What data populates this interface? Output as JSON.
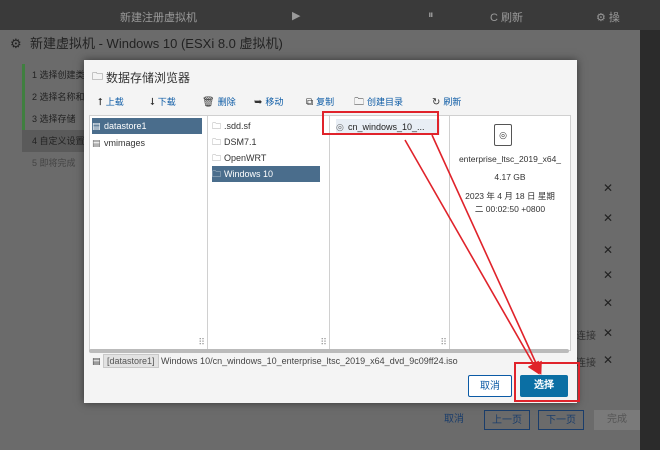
{
  "background_app": {
    "topbar_items": [
      "新建注册虚拟机",
      "▶",
      "⏸",
      "C 刷新",
      "⚙ 操"
    ],
    "window_title": "新建虚拟机 - Windows 10 (ESXi 8.0 虚拟机)",
    "steps": [
      {
        "label": "1  选择创建类型",
        "active": true
      },
      {
        "label": "2  选择名称和客",
        "active": true
      },
      {
        "label": "3  选择存储",
        "active": true
      },
      {
        "label": "4  自定义设置",
        "active": false
      },
      {
        "label": "5  即将完成",
        "active": false
      }
    ],
    "right_labels": [
      "连接",
      "连接"
    ],
    "footer": {
      "cancel": "取消",
      "back": "上一页",
      "next": "下一页",
      "finish": "完成"
    }
  },
  "dialog": {
    "title": "数据存储浏览器",
    "toolbar": {
      "upload": "上载",
      "download": "下载",
      "delete": "删除",
      "move": "移动",
      "copy": "复制",
      "create_dir": "创建目录",
      "refresh": "刷新"
    },
    "datastores": [
      {
        "name": "datastore1",
        "selected": true
      },
      {
        "name": "vmimages",
        "selected": false
      }
    ],
    "folders": [
      {
        "name": ".sdd.sf",
        "selected": false
      },
      {
        "name": "DSM7.1",
        "selected": false
      },
      {
        "name": "OpenWRT",
        "selected": false
      },
      {
        "name": "Windows 10",
        "selected": true
      }
    ],
    "files": [
      {
        "name": "cn_windows_10_...",
        "selected": true
      }
    ],
    "details": {
      "filename": "enterprise_ltsc_2019_x64_",
      "size": "4.17 GB",
      "date_line1": "2023 年 4 月 18 日 星期",
      "date_line2": "二 00:02:50 +0800"
    },
    "path": {
      "datastore": "[datastore1]",
      "file": "Windows 10/cn_windows_10_enterprise_ltsc_2019_x64_dvd_9c09ff24.iso"
    },
    "buttons": {
      "cancel": "取消",
      "select": "选择"
    }
  }
}
